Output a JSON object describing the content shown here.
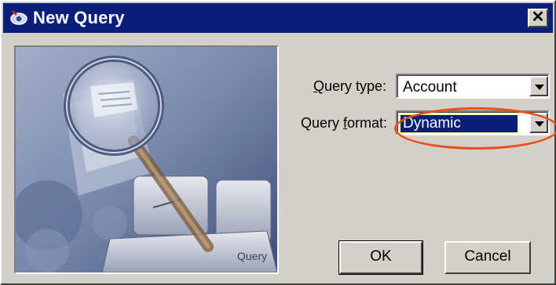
{
  "window": {
    "title": "New Query",
    "close_symbol": "✕"
  },
  "picture": {
    "caption_key_label": "Query"
  },
  "form": {
    "query_type": {
      "label_prefix": "Q",
      "label_rest": "uery type:",
      "value": "Account"
    },
    "query_format": {
      "label_prefix": "Query ",
      "label_accel": "f",
      "label_rest": "ormat:",
      "value": "Dynamic"
    }
  },
  "buttons": {
    "ok_label": "OK",
    "cancel_label": "Cancel"
  },
  "colors": {
    "titlebar": "#0a1f7a",
    "dialog_face": "#d4d0c8",
    "annotation_ring": "#e8501e"
  },
  "icons": [
    "app-query-icon",
    "close-icon",
    "chevron-down-icon",
    "magnifier-illustration"
  ]
}
